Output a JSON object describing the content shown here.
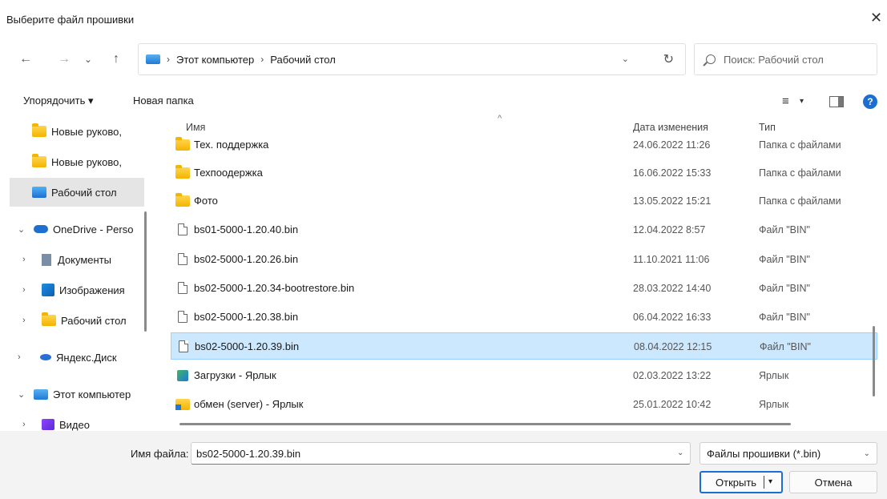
{
  "dialog": {
    "title": "Выберите файл прошивки",
    "close_glyph": "✕"
  },
  "nav": {
    "back_glyph": "←",
    "forward_glyph": "→",
    "history_glyph": "⌄",
    "up_glyph": "↑",
    "address_sep": "›",
    "address_parts": [
      "Этот компьютер",
      "Рабочий стол"
    ],
    "address_dd_glyph": "⌄",
    "refresh_glyph": "↻",
    "search_placeholder": "Поиск: Рабочий стол"
  },
  "toolbar": {
    "organize_label": "Упорядочить ▾",
    "new_folder_label": "Новая папка",
    "view_glyph": "≡",
    "view_dd_glyph": "▾",
    "help_glyph": "?"
  },
  "sidebar": {
    "items": [
      {
        "label": "Новые руково,",
        "icon": "folder-icon",
        "chev": ""
      },
      {
        "label": "Новые руково,",
        "icon": "folder-icon",
        "chev": ""
      },
      {
        "label": "Рабочий стол",
        "icon": "desktop-icon",
        "chev": "",
        "selected": true
      },
      {
        "label": "OneDrive - Perso",
        "icon": "cloud-icon",
        "chev": "⌄"
      },
      {
        "label": "Документы",
        "icon": "document-icon",
        "chev": "›"
      },
      {
        "label": "Изображения",
        "icon": "pictures-icon",
        "chev": "›"
      },
      {
        "label": "Рабочий стол",
        "icon": "folder-icon",
        "chev": "›"
      },
      {
        "label": "Яндекс.Диск",
        "icon": "yandex-disk-icon",
        "chev": "›"
      },
      {
        "label": "Этот компьютер",
        "icon": "computer-icon",
        "chev": "⌄"
      },
      {
        "label": "Видео",
        "icon": "video-icon",
        "chev": "›"
      }
    ]
  },
  "filelist": {
    "columns": {
      "name": "Имя",
      "date": "Дата изменения",
      "type": "Тип"
    },
    "sort_glyph": "^",
    "rows": [
      {
        "name": "Тех. поддержка",
        "date": "24.06.2022 11:26",
        "type": "Папка с файлами",
        "icon": "folder-icon"
      },
      {
        "name": "Техпоодержка",
        "date": "16.06.2022 15:33",
        "type": "Папка с файлами",
        "icon": "folder-icon"
      },
      {
        "name": "Фото",
        "date": "13.05.2022 15:21",
        "type": "Папка с файлами",
        "icon": "folder-icon"
      },
      {
        "name": "bs01-5000-1.20.40.bin",
        "date": "12.04.2022 8:57",
        "type": "Файл \"BIN\"",
        "icon": "file-icon"
      },
      {
        "name": "bs02-5000-1.20.26.bin",
        "date": "11.10.2021 11:06",
        "type": "Файл \"BIN\"",
        "icon": "file-icon"
      },
      {
        "name": "bs02-5000-1.20.34-bootrestore.bin",
        "date": "28.03.2022 14:40",
        "type": "Файл \"BIN\"",
        "icon": "file-icon"
      },
      {
        "name": "bs02-5000-1.20.38.bin",
        "date": "06.04.2022 16:33",
        "type": "Файл \"BIN\"",
        "icon": "file-icon"
      },
      {
        "name": "bs02-5000-1.20.39.bin",
        "date": "08.04.2022 12:15",
        "type": "Файл \"BIN\"",
        "icon": "file-icon",
        "selected": true
      },
      {
        "name": "Загрузки - Ярлык",
        "date": "02.03.2022 13:22",
        "type": "Ярлык",
        "icon": "shortcut-icon"
      },
      {
        "name": "обмен (server) - Ярлык",
        "date": "25.01.2022 10:42",
        "type": "Ярлык",
        "icon": "shortcut-folder-icon"
      }
    ]
  },
  "footer": {
    "filename_label": "Имя файла:",
    "filename_value": "bs02-5000-1.20.39.bin",
    "filename_dd_glyph": "⌄",
    "filter_value": "Файлы прошивки (*.bin)",
    "filter_dd_glyph": "⌄",
    "open_label": "Открыть",
    "open_arrow_glyph": "▾",
    "cancel_label": "Отмена"
  },
  "colors": {
    "accent": "#1c6fd1",
    "selection_bg": "#cce8ff",
    "footer_bg": "#f3f3f3"
  }
}
